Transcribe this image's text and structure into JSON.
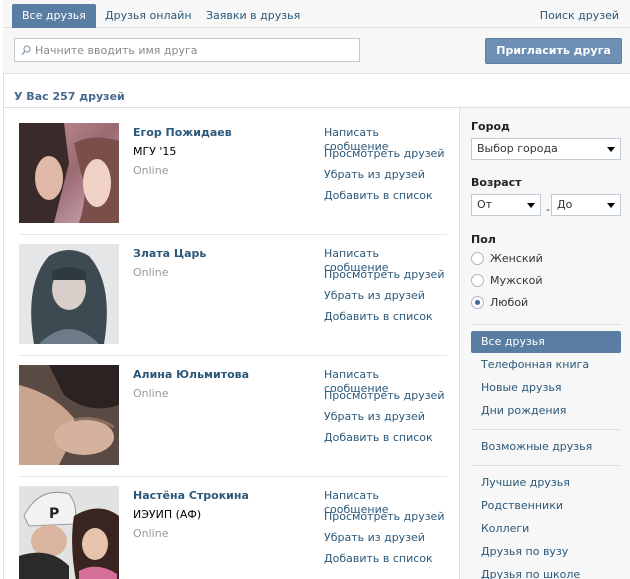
{
  "tabs": {
    "all": "Все друзья",
    "online": "Друзья онлайн",
    "requests": "Заявки в друзья",
    "search": "Поиск друзей"
  },
  "search": {
    "placeholder": "Начните вводить имя друга",
    "invite_label": "Пригласить друга"
  },
  "friends_count": "У Вас 257 друзей",
  "actions": {
    "message": "Написать сообщение",
    "view_friends": "Просмотреть друзей",
    "remove": "Убрать из друзей",
    "add_to_list": "Добавить в список"
  },
  "friends": [
    {
      "name": "Егор Пожидаев",
      "university": "МГУ '15",
      "status": "Online"
    },
    {
      "name": "Злата Царь",
      "status": "Online"
    },
    {
      "name": "Алина Юльмитова",
      "status": "Online"
    },
    {
      "name": "Настёна Строкина",
      "university": "ИЭУИП (АФ)",
      "status": "Online"
    }
  ],
  "filters": {
    "city_label": "Город",
    "city_select": "Выбор города",
    "age_label": "Возраст",
    "age_from": "От",
    "age_to": "До",
    "age_dash": "-",
    "sex_label": "Пол",
    "sex_female": "Женский",
    "sex_male": "Мужской",
    "sex_any": "Любой",
    "sex_selected": "any"
  },
  "menu": {
    "all_friends": "Все друзья",
    "phonebook": "Телефонная книга",
    "new_friends": "Новые друзья",
    "birthdays": "Дни рождения",
    "possible_friends": "Возможные друзья",
    "best_friends": "Лучшие друзья",
    "relatives": "Родственники",
    "colleagues": "Коллеги",
    "uni_friends": "Друзья по вузу",
    "school_friends": "Друзья по школе"
  },
  "colors": {
    "accent": "#597da3",
    "link": "#2b587a",
    "button": "#6d8fb3"
  }
}
